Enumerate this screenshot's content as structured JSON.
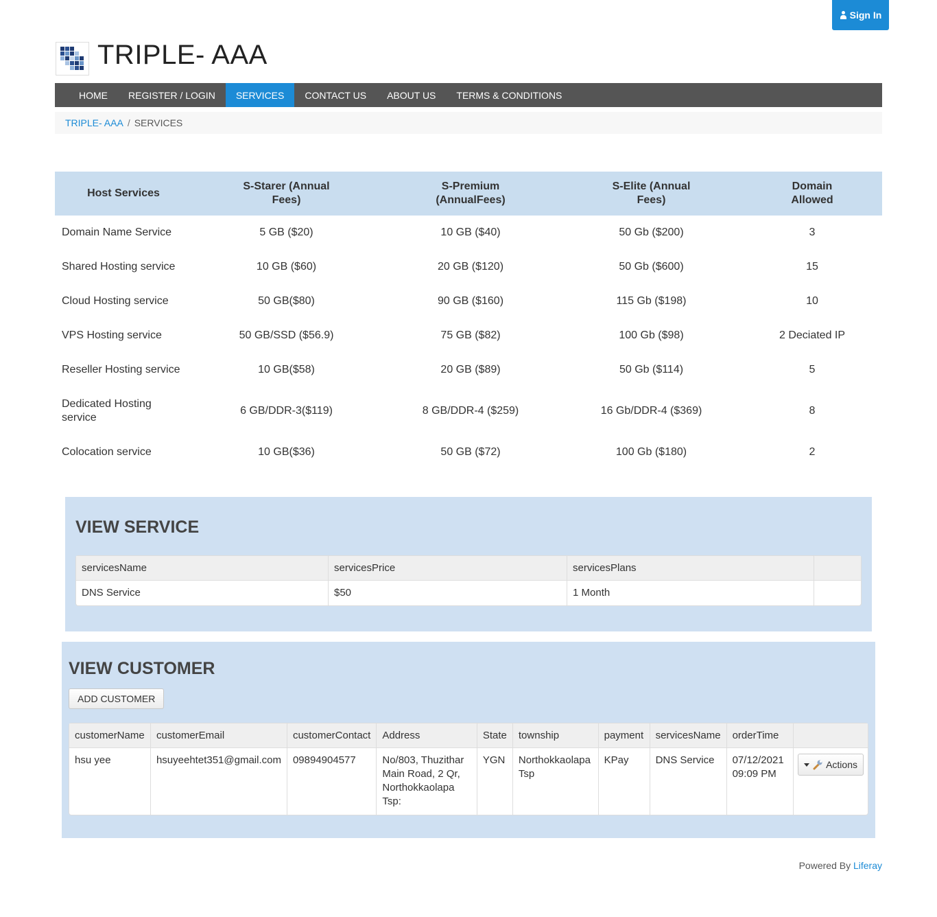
{
  "header": {
    "signin_label": "Sign In",
    "site_title": "TRIPLE- AAA"
  },
  "nav": {
    "items": [
      "HOME",
      "REGISTER / LOGIN",
      "SERVICES",
      "CONTACT US",
      "ABOUT US",
      "TERMS & CONDITIONS"
    ],
    "active": "SERVICES"
  },
  "breadcrumb": {
    "home": "TRIPLE- AAA",
    "separator": "/",
    "current": "SERVICES"
  },
  "pricing": {
    "headers": [
      "Host Services",
      "S-Starer (Annual Fees)",
      "S-Premium (AnnualFees)",
      "S-Elite (Annual Fees)",
      "Domain Allowed"
    ],
    "rows": [
      [
        "Domain Name Service",
        "5 GB ($20)",
        "10 GB ($40)",
        "50 Gb ($200)",
        "3"
      ],
      [
        "Shared Hosting service",
        "10 GB ($60)",
        "20 GB ($120)",
        "50 Gb ($600)",
        "15"
      ],
      [
        "Cloud Hosting service",
        "50 GB($80)",
        "90 GB ($160)",
        "115 Gb ($198)",
        "10"
      ],
      [
        "VPS Hosting service",
        "50 GB/SSD ($56.9)",
        "75 GB ($82)",
        "100 Gb ($98)",
        "2 Deciated IP"
      ],
      [
        "Reseller Hosting service",
        "10 GB($58)",
        "20 GB ($89)",
        "50 Gb ($114)",
        "5"
      ],
      [
        "Dedicated Hosting service",
        "6 GB/DDR-3($119)",
        "8 GB/DDR-4 ($259)",
        "16 Gb/DDR-4 ($369)",
        "8"
      ],
      [
        "Colocation service",
        "10 GB($36)",
        "50 GB ($72)",
        "100 Gb ($180)",
        "2"
      ]
    ]
  },
  "view_service": {
    "title": "VIEW SERVICE",
    "headers": [
      "servicesName",
      "servicesPrice",
      "servicesPlans",
      ""
    ],
    "rows": [
      [
        "DNS Service",
        "$50",
        "1 Month",
        ""
      ]
    ]
  },
  "view_customer": {
    "title": "VIEW CUSTOMER",
    "add_button": "ADD CUSTOMER",
    "headers": [
      "customerName",
      "customerEmail",
      "customerContact",
      "Address",
      "State",
      "township",
      "payment",
      "servicesName",
      "orderTime",
      ""
    ],
    "rows": [
      [
        "hsu yee",
        "hsuyeehtet351@gmail.com",
        "09894904577",
        "No/803, Thuzithar Main Road, 2 Qr, Northokkaolapa Tsp:",
        "YGN",
        "Northokkaolapa Tsp",
        "KPay",
        "DNS Service",
        "07/12/2021 09:09 PM"
      ]
    ],
    "actions_label": "Actions"
  },
  "footer": {
    "powered_by": "Powered By",
    "brand": "Liferay"
  },
  "colors": {
    "accent": "#1c8bd6",
    "nav_bg": "#555555",
    "table_header_bg": "#c9ddef",
    "panel_bg": "#cfe0f2"
  }
}
